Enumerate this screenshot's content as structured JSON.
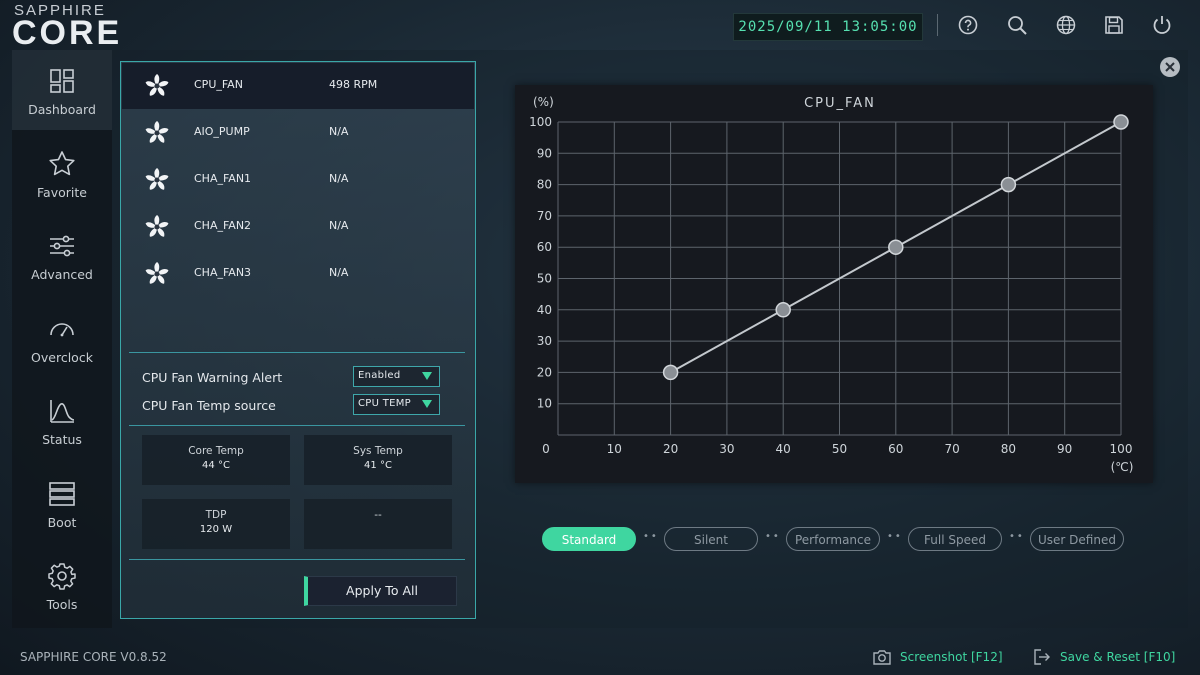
{
  "brand": {
    "top": "SAPPHIRE",
    "main": "CORE"
  },
  "header": {
    "datetime": "2025/09/11 13:05:00",
    "icons": [
      "help-icon",
      "search-icon",
      "globe-icon",
      "save-icon",
      "power-icon"
    ]
  },
  "sidebar": {
    "items": [
      {
        "label": "Dashboard",
        "icon": "dashboard-icon"
      },
      {
        "label": "Favorite",
        "icon": "star-icon"
      },
      {
        "label": "Advanced",
        "icon": "sliders-icon"
      },
      {
        "label": "Overclock",
        "icon": "gauge-icon"
      },
      {
        "label": "Status",
        "icon": "status-chart-icon"
      },
      {
        "label": "Boot",
        "icon": "boot-icon"
      },
      {
        "label": "Tools",
        "icon": "gear-icon"
      }
    ]
  },
  "fans": [
    {
      "name": "CPU_FAN",
      "value": "498 RPM"
    },
    {
      "name": "AIO_PUMP",
      "value": "N/A"
    },
    {
      "name": "CHA_FAN1",
      "value": "N/A"
    },
    {
      "name": "CHA_FAN2",
      "value": "N/A"
    },
    {
      "name": "CHA_FAN3",
      "value": "N/A"
    }
  ],
  "settings": {
    "warning_label": "CPU Fan Warning Alert",
    "warning_value": "Enabled",
    "source_label": "CPU Fan Temp source",
    "source_value": "CPU TEMP"
  },
  "stats": {
    "core_title": "Core Temp",
    "core_value": "44 °C",
    "sys_title": "Sys Temp",
    "sys_value": "41 °C",
    "tdp_title": "TDP",
    "tdp_value": "120 W",
    "empty_value": "--"
  },
  "apply_label": "Apply To All",
  "chart_data": {
    "type": "line",
    "title": "CPU_FAN",
    "ylabel": "(%)",
    "xlabel": "(℃)",
    "xlim": [
      0,
      100
    ],
    "ylim": [
      0,
      100
    ],
    "x_ticks": [
      0,
      10,
      20,
      30,
      40,
      50,
      60,
      70,
      80,
      90,
      100
    ],
    "y_ticks": [
      10,
      20,
      30,
      40,
      50,
      60,
      70,
      80,
      90,
      100
    ],
    "grid": true,
    "series": [
      {
        "x": [
          20,
          40,
          60,
          80,
          100
        ],
        "y": [
          20,
          40,
          60,
          80,
          100
        ]
      }
    ]
  },
  "modes": [
    "Standard",
    "Silent",
    "Performance",
    "Full Speed",
    "User Defined"
  ],
  "active_mode": "Standard",
  "footer": {
    "version": "SAPPHIRE CORE V0.8.52",
    "screenshot": "Screenshot [F12]",
    "save_reset": "Save & Reset [F10]"
  },
  "colors": {
    "accent": "#3fd6a0",
    "border": "#3aa7a8"
  }
}
